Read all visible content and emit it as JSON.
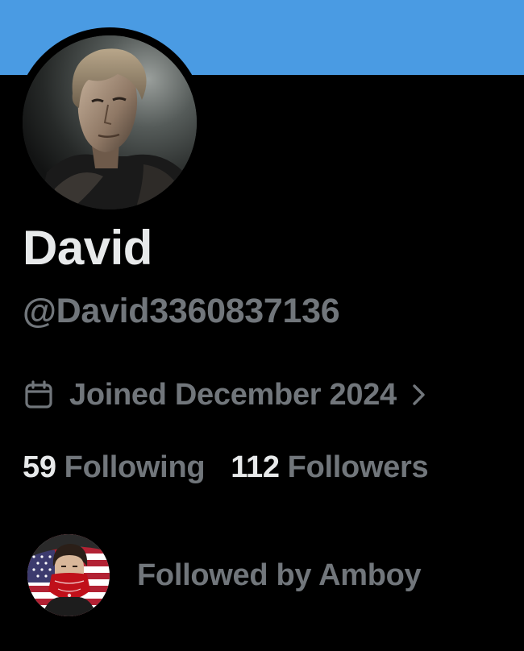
{
  "profile": {
    "banner_color": "#4a9be3",
    "avatar_icon": "profile-photo",
    "display_name": "David",
    "handle": "@David3360837136",
    "joined": {
      "icon": "calendar-icon",
      "text": "Joined December 2024",
      "chevron": "chevron-right-icon"
    },
    "stats": {
      "following_count": "59",
      "following_label": "Following",
      "followers_count": "112",
      "followers_label": "Followers"
    },
    "followed_by": {
      "avatar_icon": "follower-avatar",
      "text": "Followed by Amboy"
    }
  },
  "colors": {
    "background": "#000000",
    "primary_text": "#e7e9ea",
    "secondary_text": "#71767b"
  }
}
